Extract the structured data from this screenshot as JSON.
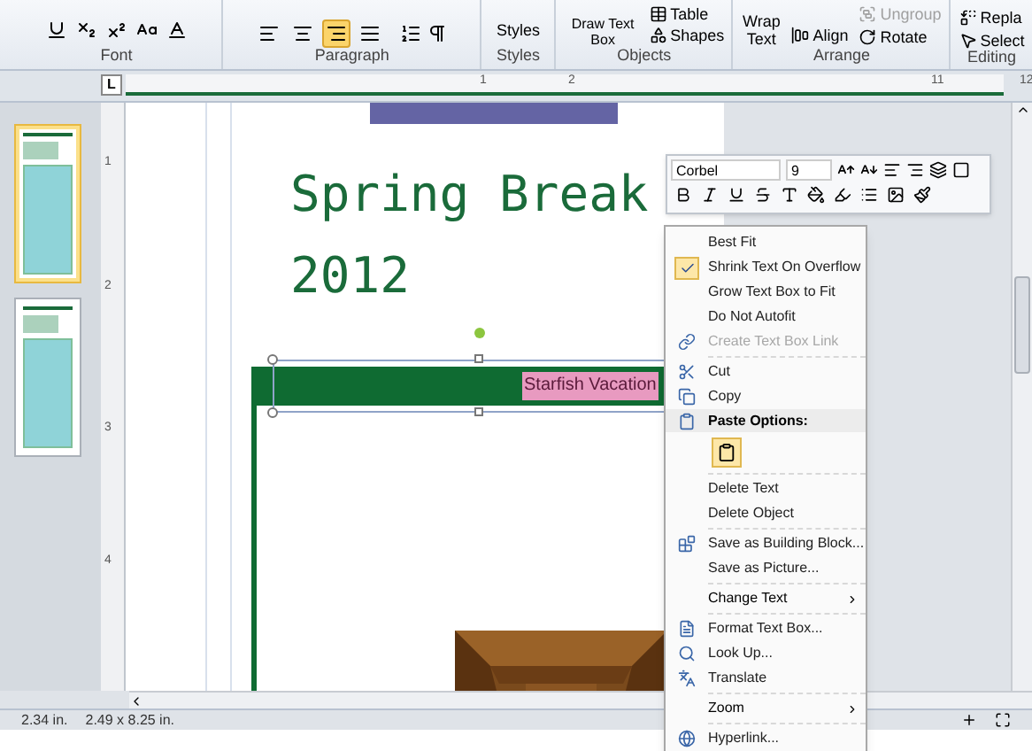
{
  "ribbon": {
    "font": {
      "label": "Font"
    },
    "paragraph": {
      "label": "Paragraph",
      "align_buttons": [
        {
          "selected": false
        },
        {
          "selected": false
        },
        {
          "selected": true
        },
        {
          "selected": false
        }
      ]
    },
    "styles": {
      "button": "Styles",
      "label": "Styles"
    },
    "objects": {
      "draw_text_box": "Draw Text Box",
      "table": "Table",
      "shapes": "Shapes",
      "label": "Objects"
    },
    "arrange": {
      "wrap_text": "Wrap Text",
      "align": "Align",
      "ungroup": {
        "label": "Ungroup",
        "disabled": true
      },
      "rotate": "Rotate",
      "label": "Arrange"
    },
    "editing": {
      "replace": "Repla",
      "select": "Select",
      "label": "Editing"
    }
  },
  "horizontal_ruler": {
    "tab_selector": "L",
    "labels": [
      "1",
      "2",
      "11",
      "12"
    ]
  },
  "vertical_ruler": {
    "labels": [
      "1",
      "2",
      "3",
      "4"
    ]
  },
  "page_thumbnails": [
    {
      "selected": true
    },
    {
      "selected": false
    }
  ],
  "page": {
    "title": "Spring Break",
    "subtitle": "2012",
    "banner_text": "Starfish Vacation"
  },
  "mini_toolbar": {
    "font": "Corbel",
    "size": "9"
  },
  "context_menu": [
    {
      "kind": "item",
      "label": "Best Fit",
      "checked": false,
      "disabled": false
    },
    {
      "kind": "item",
      "label": "Shrink Text On Overflow",
      "checked": true,
      "disabled": false
    },
    {
      "kind": "item",
      "label": "Grow Text Box to Fit",
      "checked": false,
      "disabled": false
    },
    {
      "kind": "item",
      "label": "Do Not Autofit",
      "checked": false,
      "disabled": false
    },
    {
      "kind": "item",
      "label": "Create Text Box Link",
      "checked": false,
      "disabled": true
    },
    {
      "kind": "separator"
    },
    {
      "kind": "item",
      "label": "Cut",
      "checked": false,
      "disabled": false
    },
    {
      "kind": "item",
      "label": "Copy",
      "checked": false,
      "disabled": false
    },
    {
      "kind": "header",
      "label": "Paste Options:"
    },
    {
      "kind": "paste"
    },
    {
      "kind": "separator"
    },
    {
      "kind": "item",
      "label": "Delete Text",
      "checked": false,
      "disabled": false
    },
    {
      "kind": "item",
      "label": "Delete Object",
      "checked": false,
      "disabled": false
    },
    {
      "kind": "separator"
    },
    {
      "kind": "item",
      "label": "Save as Building Block...",
      "checked": false,
      "disabled": false
    },
    {
      "kind": "item",
      "label": "Save as Picture...",
      "checked": false,
      "disabled": false
    },
    {
      "kind": "separator"
    },
    {
      "kind": "submenu",
      "label": "Change Text"
    },
    {
      "kind": "separator"
    },
    {
      "kind": "item",
      "label": "Format Text Box...",
      "checked": false,
      "disabled": false
    },
    {
      "kind": "item",
      "label": "Look Up...",
      "checked": false,
      "disabled": false
    },
    {
      "kind": "item",
      "label": "Translate",
      "checked": false,
      "disabled": false
    },
    {
      "kind": "separator"
    },
    {
      "kind": "submenu",
      "label": "Zoom"
    },
    {
      "kind": "separator"
    },
    {
      "kind": "item",
      "label": "Hyperlink...",
      "checked": false,
      "disabled": false
    }
  ],
  "status_bar": {
    "position": "2.34 in.",
    "size": "2.49 x 8.25 in."
  }
}
